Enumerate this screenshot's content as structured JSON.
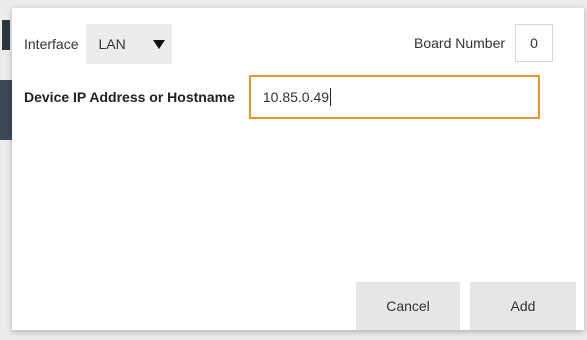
{
  "dialog": {
    "interface_label": "Interface",
    "interface_value": "LAN",
    "board_number_label": "Board Number",
    "board_number_value": "0",
    "device_address_label": "Device IP Address or Hostname",
    "device_address_value": "10.85.0.49",
    "cancel_label": "Cancel",
    "add_label": "Add"
  },
  "colors": {
    "focus_border": "#e8962c",
    "button_bg": "#e6e6e6",
    "select_bg": "#ececec"
  },
  "icons": {
    "interface_dropdown": "triangle-down-icon"
  }
}
